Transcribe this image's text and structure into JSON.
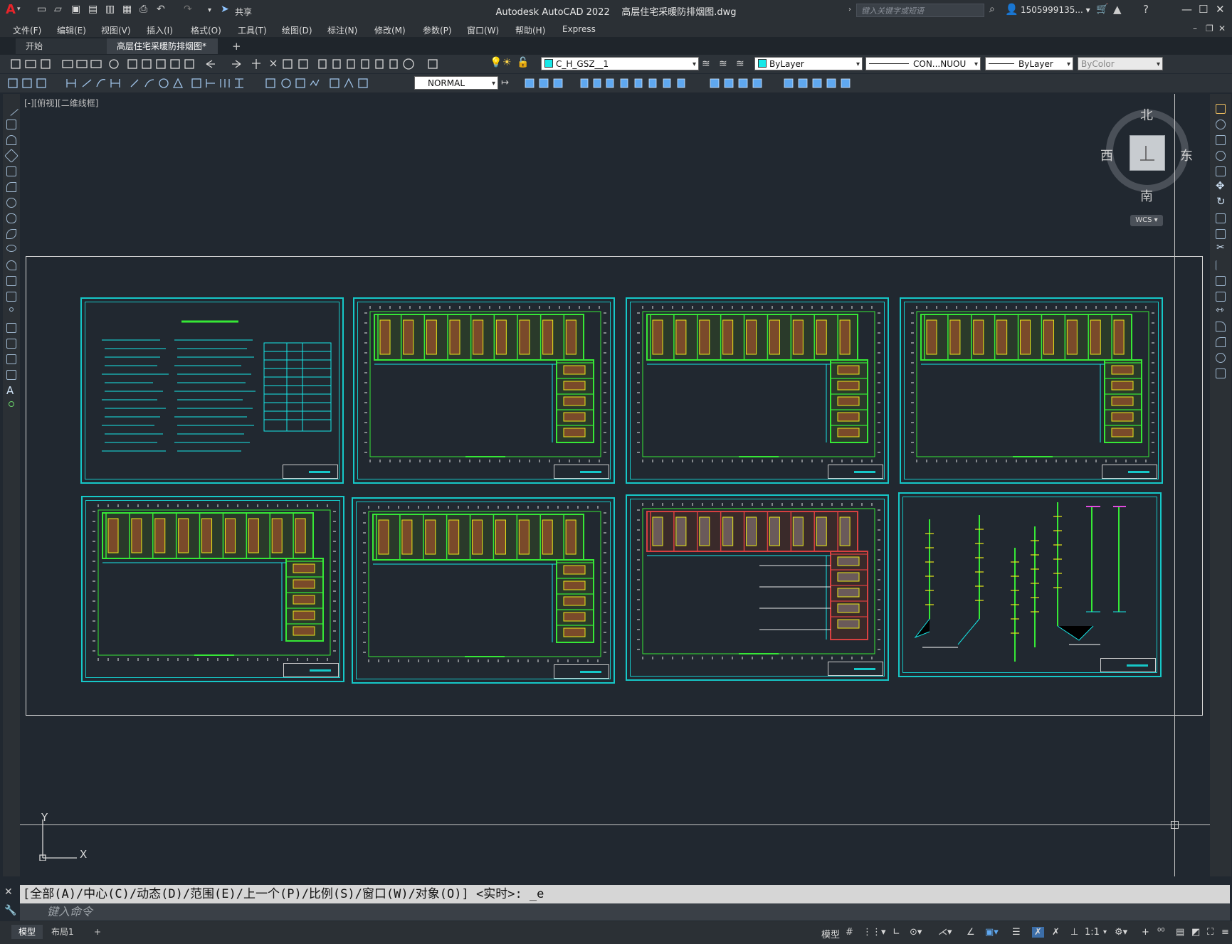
{
  "window": {
    "app_title": "Autodesk AutoCAD 2022",
    "file_title": "高层住宅采暖防排烟图.dwg",
    "search_placeholder": "键入关键字或短语",
    "user": "1505999135... ▾",
    "share_label": "共享"
  },
  "menu": [
    "文件(F)",
    "编辑(E)",
    "视图(V)",
    "插入(I)",
    "格式(O)",
    "工具(T)",
    "绘图(D)",
    "标注(N)",
    "修改(M)",
    "参数(P)",
    "窗口(W)",
    "帮助(H)",
    "Express"
  ],
  "tabs": {
    "start": "开始",
    "document": "高层住宅采暖防排烟图*",
    "add": "+"
  },
  "toolbar": {
    "layer": "C_H_GSZ__1",
    "color": "ByLayer",
    "linetype": "CON...NUOU",
    "lineweight": "ByLayer",
    "plotstyle": "ByColor",
    "dimstyle": "NORMAL"
  },
  "viewport_label": "[-][俯视][二维线框]",
  "viewcube": {
    "north": "北",
    "south": "南",
    "east": "东",
    "west": "西",
    "wcs": "WCS"
  },
  "ucs": {
    "x": "X",
    "y": "Y"
  },
  "command": {
    "history": "[全部(A)/中心(C)/动态(D)/范围(E)/上一个(P)/比例(S)/窗口(W)/对象(O)] <实时>: _e",
    "input_placeholder": "键入命令"
  },
  "layout_tabs": [
    "模型",
    "布局1",
    "+"
  ],
  "status": {
    "model": "模型",
    "scale": "1:1"
  },
  "colors": {
    "sheet_border": "#16c8c8",
    "plan_green": "#36e836",
    "plan_yellow": "#e8e81a",
    "plan_red": "#d84040",
    "background": "#212830"
  }
}
